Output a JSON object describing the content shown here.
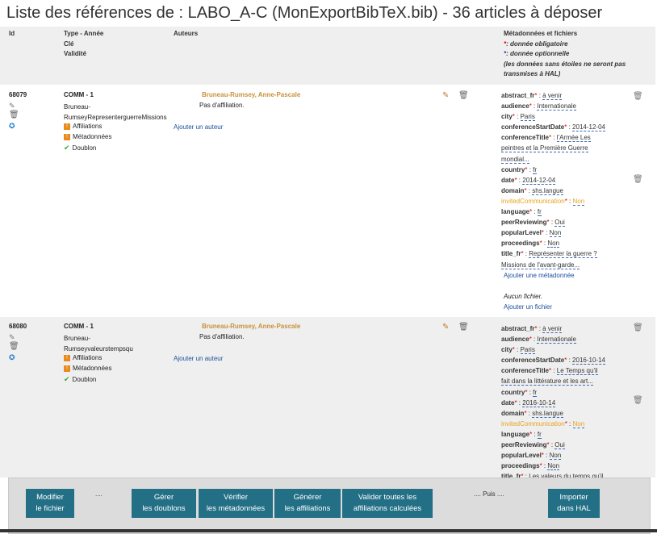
{
  "page_title": "Liste des références de : LABO_A-C (MonExportBibTeX.bib) - 36 articles à déposer",
  "header": {
    "col_id": "Id",
    "col_type_line1": "Type - Année",
    "col_type_line2": "Clé",
    "col_type_line3": "Validité",
    "col_authors": "Auteurs",
    "col_meta": "Métadonnées et fichiers",
    "legend_required": ": donnée obligatoire",
    "legend_optional": ": donnée optionnelle",
    "legend_note_line1": "(les données sans étoiles ne seront pas",
    "legend_note_line2": "transmises à HAL)"
  },
  "records": [
    {
      "id": "68079",
      "type": "COMM - 1",
      "key_line1": "Bruneau-",
      "key_line2": "RumseyRepresenterguerreMissions",
      "validity": [
        "Affiliations",
        "Métadonnées",
        "Doublon"
      ],
      "author": "Bruneau-Rumsey, Anne-Pascale",
      "affiliation": "Pas d'affiliation.",
      "add_author": "Ajouter un auteur",
      "meta": {
        "abstract_fr": "à venir",
        "audience": "Internationale",
        "city": "Paris",
        "conferenceStartDate": "2014-12-04",
        "conferenceTitle_1": "l'Armée Les",
        "conferenceTitle_2": "peintres et la Première Guerre",
        "conferenceTitle_3": "mondial...",
        "country": "fr",
        "date": "2014-12-04",
        "domain": "shs.langue",
        "invitedCommunication": "Non",
        "language": "fr",
        "peerReviewing": "Oui",
        "popularLevel": "Non",
        "proceedings": "Non",
        "title_fr_1": "Représenter la guerre ?",
        "title_fr_2": "Missions de l'avant-garde..."
      },
      "add_meta": "Ajouter une métadonnée",
      "no_file": "Aucun fichier.",
      "add_file": "Ajouter un fichier"
    },
    {
      "id": "68080",
      "type": "COMM - 1",
      "key_line1": "Bruneau-",
      "key_line2": "Rumseyvaleurstempsqu",
      "validity": [
        "Affiliations",
        "Métadonnées",
        "Doublon"
      ],
      "author": "Bruneau-Rumsey, Anne-Pascale",
      "affiliation": "Pas d'affiliation.",
      "add_author": "Ajouter un auteur",
      "meta": {
        "abstract_fr": "à venir",
        "audience": "Internationale",
        "city": "Paris",
        "conferenceStartDate": "2016-10-14",
        "conferenceTitle_1": "Le Temps qu'il",
        "conferenceTitle_2": "fait dans la littérature et les art...",
        "country": "fr",
        "date": "2016-10-14",
        "domain": "shs.langue",
        "invitedCommunication": "Non",
        "language": "fr",
        "peerReviewing": "Oui",
        "popularLevel": "Non",
        "proceedings": "Non",
        "title_fr_1": "Les valeurs du temps qu'il"
      }
    }
  ],
  "keys": {
    "abstract_fr": "abstract_fr",
    "audience": "audience",
    "city": "city",
    "conferenceStartDate": "conferenceStartDate",
    "conferenceTitle": "conferenceTitle",
    "country": "country",
    "date": "date",
    "domain": "domain",
    "invitedCommunication": "invitedCommunication",
    "language": "language",
    "peerReviewing": "peerReviewing",
    "popularLevel": "popularLevel",
    "proceedings": "proceedings",
    "title_fr": "title_fr"
  },
  "toolbar": {
    "modify_1": "Modifier",
    "modify_2": "le fichier",
    "dots_1": "....",
    "dupes_1": "Gérer",
    "dupes_2": "les doublons",
    "check_1": "Vérifier",
    "check_2": "les métadonnées",
    "aff_1": "Générer",
    "aff_2": "les affiliations",
    "validate_1": "Valider toutes les",
    "validate_2": "affiliations calculées",
    "then": ".... Puis ....",
    "import_1": "Importer",
    "import_2": "dans HAL"
  },
  "colors": {
    "button": "#236f86",
    "author": "#c8913c",
    "link": "#1b4f9c",
    "optional": "#e8a31e"
  },
  "icons": [
    "edit-icon",
    "trash-icon",
    "hal-icon",
    "warning-icon",
    "check-icon"
  ]
}
